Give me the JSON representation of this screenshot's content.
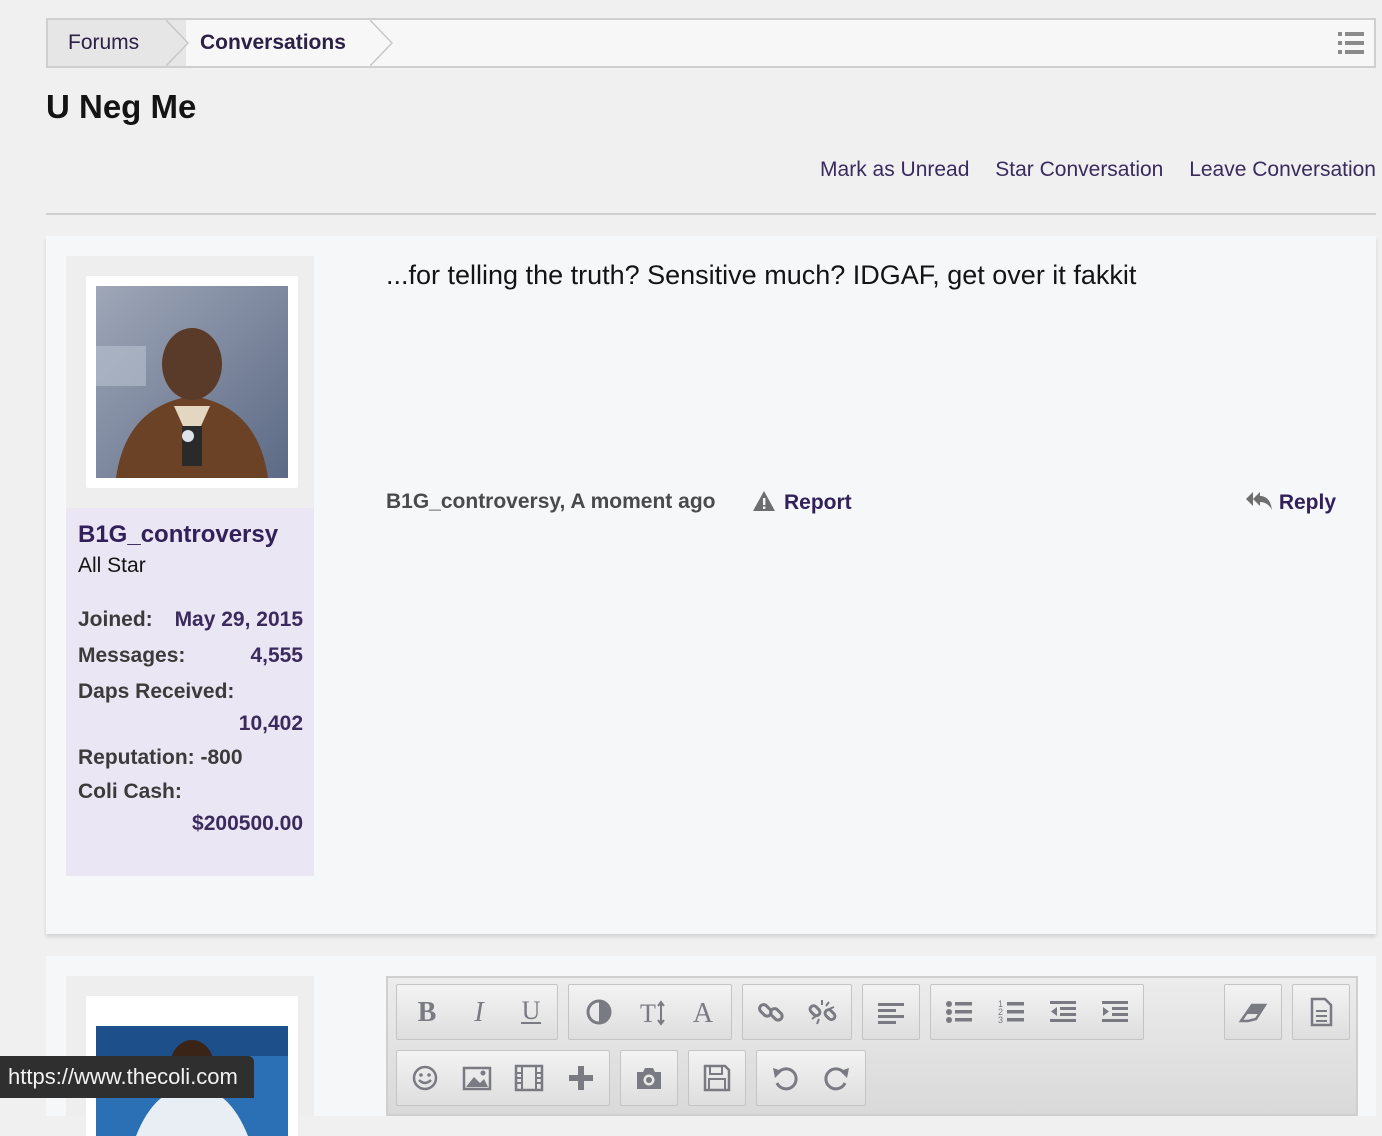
{
  "breadcrumb": {
    "items": [
      "Forums",
      "Conversations"
    ]
  },
  "page": {
    "title": "U Neg Me"
  },
  "actions": {
    "mark_unread": "Mark as Unread",
    "star": "Star Conversation",
    "leave": "Leave Conversation"
  },
  "message": {
    "text": "...for telling the truth? Sensitive much? IDGAF, get over it fakkit",
    "meta": "B1G_controversy, A moment ago",
    "report_label": "Report",
    "reply_label": "Reply"
  },
  "user": {
    "name": "B1G_controversy",
    "title": "All Star",
    "joined_label": "Joined:",
    "joined_value": "May 29, 2015",
    "messages_label": "Messages:",
    "messages_value": "4,555",
    "daps_label": "Daps Received:",
    "daps_value": "10,402",
    "reputation_label": "Reputation:",
    "reputation_value": "-800",
    "cash_label": "Coli Cash:",
    "cash_value": "$200500.00"
  },
  "status_bar": {
    "url": "https://www.thecoli.com"
  },
  "colors": {
    "link": "#31205a",
    "user_panel": "#ebe6f3",
    "accent_purple": "#3a2a5e"
  }
}
